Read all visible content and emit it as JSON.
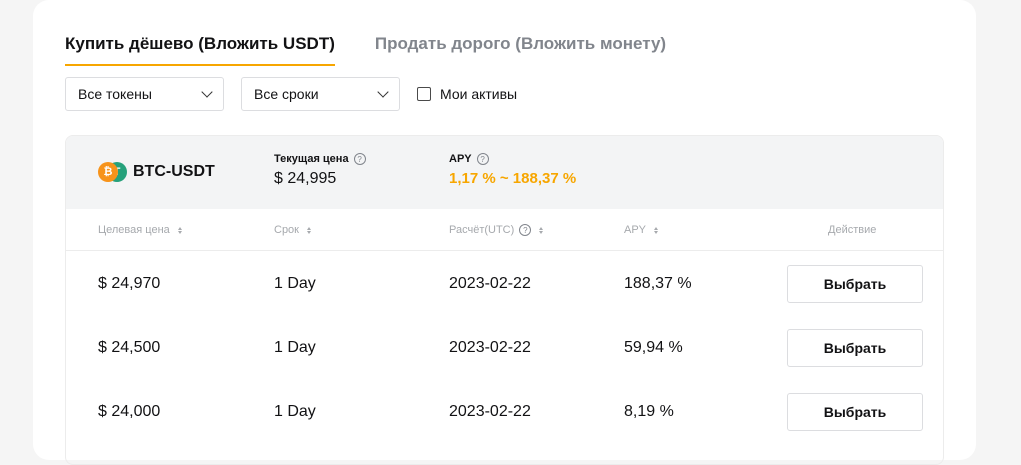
{
  "tabs": [
    {
      "label": "Купить дёшево (Вложить USDT)",
      "active": true
    },
    {
      "label": "Продать дорого (Вложить монету)",
      "active": false
    }
  ],
  "filters": {
    "tokens": "Все токены",
    "terms": "Все сроки",
    "my_assets": "Мои активы"
  },
  "pair": {
    "name": "BTC-USDT",
    "btc_glyph": "₿",
    "usdt_glyph": "T",
    "current_price_label": "Текущая цена",
    "current_price": "$ 24,995",
    "apy_label": "APY",
    "apy_range": "1,17 % ~ 188,37 %"
  },
  "help_glyph": "?",
  "columns": {
    "target_price": "Целевая цена",
    "term": "Срок",
    "settlement": "Расчёт(UTC)",
    "apy": "APY",
    "action": "Действие"
  },
  "rows": [
    {
      "price": "$ 24,970",
      "term": "1 Day",
      "date": "2023-02-22",
      "apy": "188,37 %",
      "action": "Выбрать"
    },
    {
      "price": "$ 24,500",
      "term": "1 Day",
      "date": "2023-02-22",
      "apy": "59,94 %",
      "action": "Выбрать"
    },
    {
      "price": "$ 24,000",
      "term": "1 Day",
      "date": "2023-02-22",
      "apy": "8,19 %",
      "action": "Выбрать"
    }
  ],
  "colors": {
    "accent": "#f7a600",
    "btc": "#f7931a",
    "usdt": "#26a17b"
  }
}
